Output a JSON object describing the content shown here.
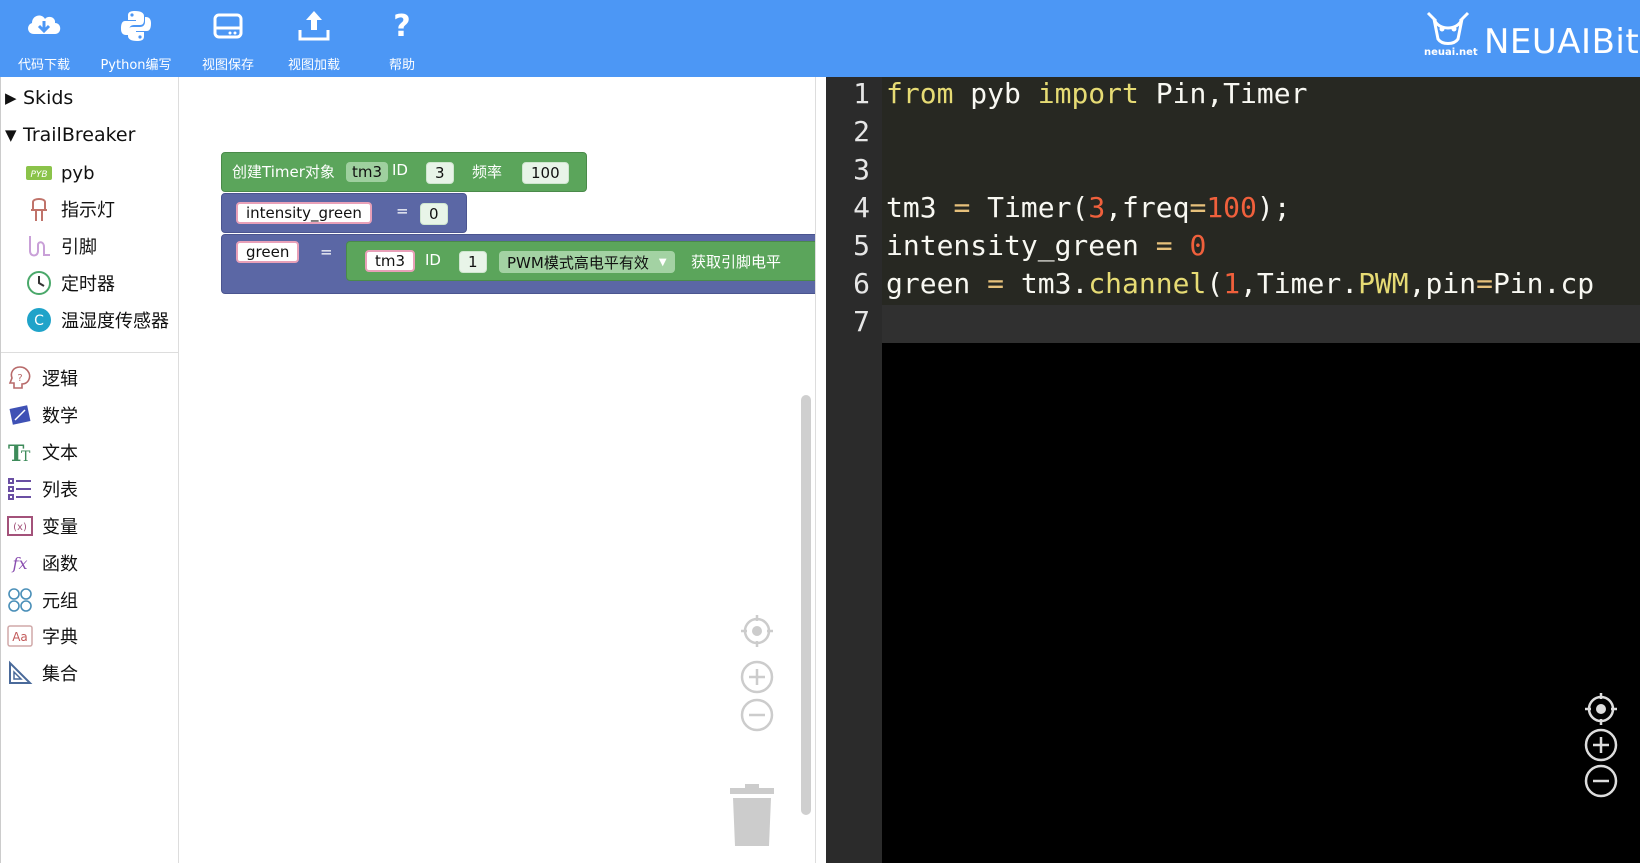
{
  "toolbar": {
    "buttons": [
      {
        "label": "代码下载",
        "icon": "cloud-download-icon"
      },
      {
        "label": "Python编写",
        "icon": "python-icon"
      },
      {
        "label": "视图保存",
        "icon": "save-drive-icon"
      },
      {
        "label": "视图加载",
        "icon": "upload-icon"
      },
      {
        "label": "帮助",
        "icon": "help-icon"
      }
    ],
    "brand": {
      "name": "NEUAIBit",
      "sub": "neuai.net"
    }
  },
  "toolbox": {
    "groups": [
      {
        "label": "Skids",
        "expanded": false
      },
      {
        "label": "TrailBreaker",
        "expanded": true
      }
    ],
    "trail_items": [
      {
        "label": "pyb",
        "icon": "pyb-icon"
      },
      {
        "label": "指示灯",
        "icon": "led-icon"
      },
      {
        "label": "引脚",
        "icon": "pin-icon"
      },
      {
        "label": "定时器",
        "icon": "clock-icon"
      },
      {
        "label": "温湿度传感器",
        "icon": "sensor-icon"
      }
    ],
    "categories": [
      {
        "label": "逻辑",
        "icon": "logic-icon"
      },
      {
        "label": "数学",
        "icon": "math-icon"
      },
      {
        "label": "文本",
        "icon": "text-icon"
      },
      {
        "label": "列表",
        "icon": "list-icon"
      },
      {
        "label": "变量",
        "icon": "variable-icon"
      },
      {
        "label": "函数",
        "icon": "function-icon"
      },
      {
        "label": "元组",
        "icon": "tuple-icon"
      },
      {
        "label": "字典",
        "icon": "dict-icon"
      },
      {
        "label": "集合",
        "icon": "set-icon"
      }
    ]
  },
  "blocks": {
    "timer": {
      "label": "创建Timer对象",
      "var": "tm3",
      "id_label": "ID",
      "id": "3",
      "freq_label": "频率",
      "freq": "100"
    },
    "intensity": {
      "var": "intensity_green",
      "eq": "=",
      "value": "0"
    },
    "green": {
      "var": "green",
      "eq": "=",
      "timer_var": "tm3",
      "id_label": "ID",
      "id": "1",
      "mode": "PWM模式高电平有效",
      "get_label": "获取引脚电平"
    }
  },
  "editor": {
    "line_numbers": [
      "1",
      "2",
      "3",
      "4",
      "5",
      "6",
      "7"
    ],
    "lines": [
      "from pyb import Pin,Timer",
      "",
      "",
      "tm3 = Timer(3,freq=100);",
      "intensity_green = 0",
      "green = tm3.channel(1,Timer.PWM,pin=Pin.cp",
      ""
    ]
  },
  "colors": {
    "toolbar": "#4c97f5",
    "block_green": "#5ba55b",
    "block_blue": "#5b67a5",
    "editor_bg": "#272822"
  }
}
